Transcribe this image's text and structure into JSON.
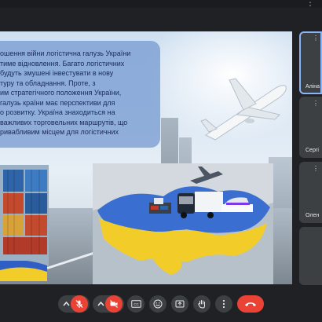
{
  "slide": {
    "text": "ошення війни логістична галузь України\nтиме відновлення. Багато логістичних\nбудуть змушені інвестувати в нову\nтуру та обладнання. Проте, з\nим стратегічного положення України,\nгалузь країни має перспективи для\nо розвитку. Україна знаходиться на\nважливих торговельних маршрутів, що\nривабливим місцем для логістичних"
  },
  "participants": [
    {
      "name": "Аліна",
      "active": true
    },
    {
      "name": "Сергі",
      "active": false
    },
    {
      "name": "Олен",
      "active": false
    },
    {
      "name": "",
      "active": false
    }
  ],
  "controls": {
    "captions_label": "CC"
  },
  "colors": {
    "background": "#202124",
    "tile": "#3c4043",
    "active_outline": "#8ab4f8",
    "leave_red": "#ea4335",
    "mute_red": "#ea4335"
  },
  "icons": [
    "more-vert-icon",
    "mic-off-icon",
    "camera-off-icon",
    "captions-icon",
    "emoji-icon",
    "present-icon",
    "raise-hand-icon",
    "more-options-icon",
    "call-end-icon"
  ]
}
